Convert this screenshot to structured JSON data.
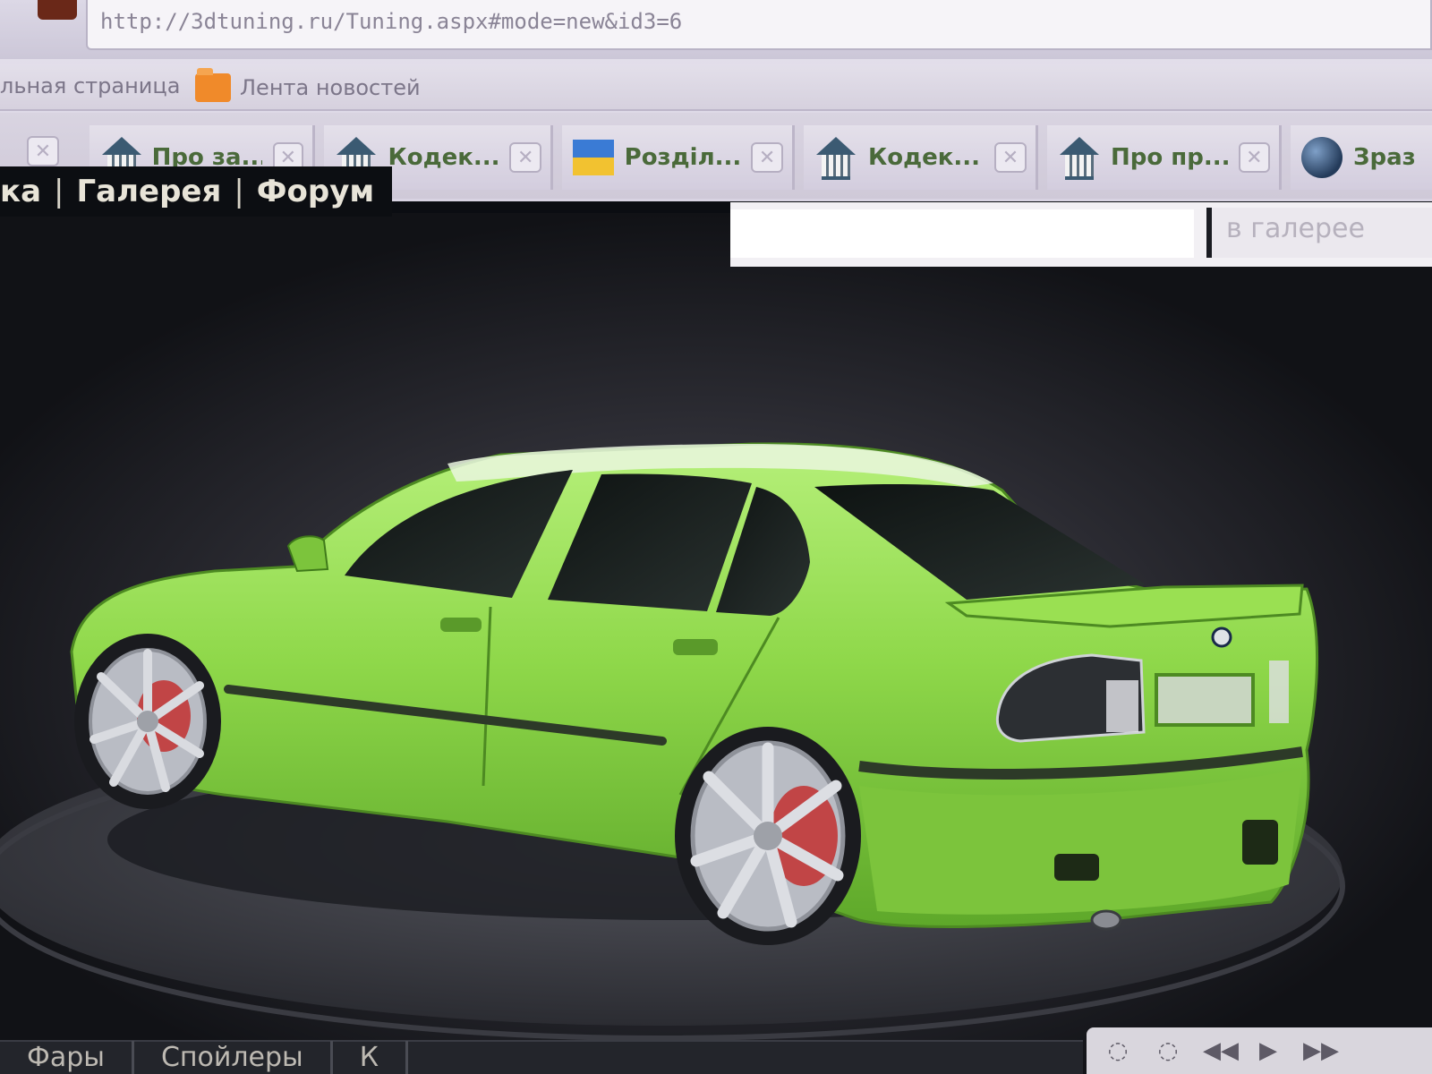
{
  "browser": {
    "address_url": "http://3dtuning.ru/Tuning.aspx#mode=new&id3=6",
    "bookmarks": [
      {
        "label": "льная страница",
        "icon": "none"
      },
      {
        "label": "Лента новостей",
        "icon": "folder-icon"
      }
    ],
    "tabs": [
      {
        "label": "Про за...",
        "icon": "house-icon"
      },
      {
        "label": "Кодек...",
        "icon": "house-icon"
      },
      {
        "label": "Розділ...",
        "icon": "flag-icon"
      },
      {
        "label": "Кодек...",
        "icon": "house-icon"
      },
      {
        "label": "Про пр...",
        "icon": "house-icon"
      },
      {
        "label": "Зраз",
        "icon": "globe-icon"
      }
    ],
    "close_glyph": "✕"
  },
  "site": {
    "nav_items": [
      "ка",
      "Галерея",
      "Форум"
    ],
    "nav_separator": "|",
    "search_value": "",
    "search_scope": "в галерее"
  },
  "scene": {
    "car_color": "#8fd84a",
    "bottom_menu": [
      "Фары",
      "Спойлеры",
      "К"
    ],
    "player_controls": [
      "◌",
      "◌",
      "◀◀",
      "▶",
      "▶▶"
    ]
  },
  "colors": {
    "chrome_bg": "#d8d3e2",
    "tab_text": "#4a6a3a",
    "scene_bg": "#2c2c33"
  }
}
